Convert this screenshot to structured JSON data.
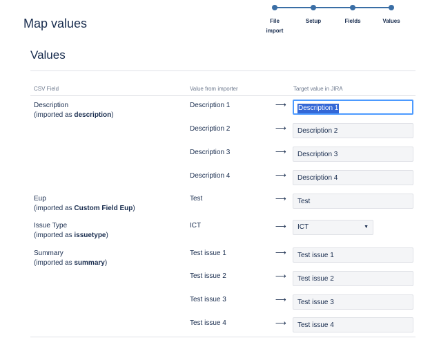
{
  "header": {
    "title": "Map values"
  },
  "stepper": {
    "steps": [
      {
        "label_line1": "File",
        "label_line2": "import"
      },
      {
        "label_line1": "Setup",
        "label_line2": ""
      },
      {
        "label_line1": "Fields",
        "label_line2": ""
      },
      {
        "label_line1": "Values",
        "label_line2": ""
      }
    ],
    "color": "#3a6ea5"
  },
  "section": {
    "title": "Values"
  },
  "table": {
    "headers": {
      "csv_field": "CSV Field",
      "importer": "Value from importer",
      "target": "Target value in JIRA"
    },
    "arrow_glyph": "⟶",
    "fields": [
      {
        "name": "Description",
        "imported_prefix": "(imported as ",
        "imported_as": "description",
        "imported_suffix": ")"
      },
      {
        "name": "Eup",
        "imported_prefix": "(imported as ",
        "imported_as": "Custom Field Eup",
        "imported_suffix": ")"
      },
      {
        "name": "Issue Type",
        "imported_prefix": "(imported as ",
        "imported_as": "issuetype",
        "imported_suffix": ")"
      },
      {
        "name": "Summary",
        "imported_prefix": "(imported as ",
        "imported_as": "summary",
        "imported_suffix": ")"
      }
    ],
    "rows": [
      {
        "importer": "Description 1",
        "target": "Description 1",
        "focused": true
      },
      {
        "importer": "Description 2",
        "target": "Description 2"
      },
      {
        "importer": "Description 3",
        "target": "Description 3"
      },
      {
        "importer": "Description 4",
        "target": "Description 4"
      },
      {
        "importer": "Test",
        "target": "Test"
      },
      {
        "importer": "ICT",
        "target": "ICT",
        "control": "select"
      },
      {
        "importer": "Test issue 1",
        "target": "Test issue 1"
      },
      {
        "importer": "Test issue 2",
        "target": "Test issue 2"
      },
      {
        "importer": "Test issue 3",
        "target": "Test issue 3"
      },
      {
        "importer": "Test issue 4",
        "target": "Test issue 4"
      }
    ]
  },
  "colors": {
    "focus_border": "#4c9aff",
    "selection": "#3367d6"
  }
}
